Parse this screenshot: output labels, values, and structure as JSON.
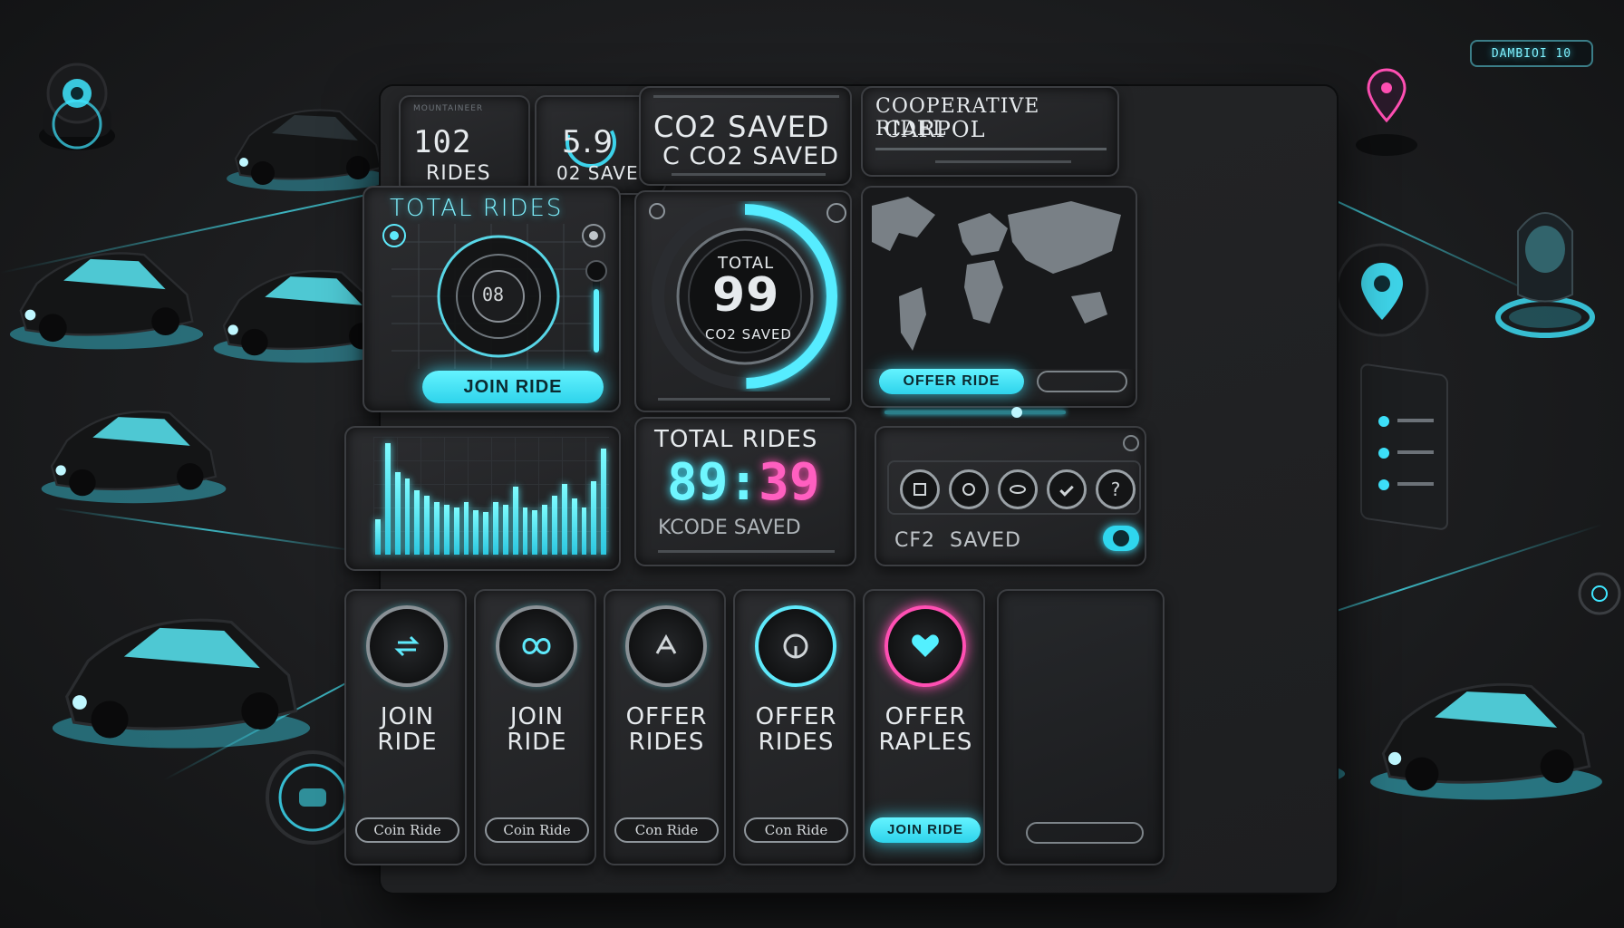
{
  "app": {
    "badge": "DAMBIOI 10"
  },
  "stats_top": {
    "rides_value": "102",
    "rides_label": "RIDES",
    "co2_value": "5.9",
    "co2_label": "02 SAVED",
    "small_header": "MOUNTAINEER"
  },
  "co2_card": {
    "line1": "CO2 SAVED",
    "line2": "C CO2 SAVED"
  },
  "cooperative_card": {
    "title_line1": "COOPERATIVE RIDEL",
    "title_line2": "CARPOL"
  },
  "total_rides_panel": {
    "title": "TOTAL RIDES",
    "center_text": "08",
    "join_button": "JOIN RIDE"
  },
  "gauge_panel": {
    "label_top": "TOTAL",
    "value": "99",
    "label_bottom": "CO2 SAVED"
  },
  "map_panel": {
    "offer_button": "OFFER RIDE"
  },
  "bar_chart": {
    "values": [
      30,
      95,
      70,
      65,
      55,
      50,
      45,
      42,
      40,
      45,
      38,
      36,
      45,
      42,
      58,
      40,
      38,
      42,
      50,
      60,
      48,
      40,
      62,
      90
    ]
  },
  "total_rides_counter": {
    "title": "TOTAL RIDES",
    "value_cyan": "89:",
    "value_pink": "39",
    "subtitle": "KCODE SAVED"
  },
  "icon_row_panel": {
    "saved_label": "CF2  SAVED"
  },
  "action_cards": [
    {
      "line1": "JOIN",
      "line2": "RIDE",
      "button": "Coin Ride",
      "icon": "swap-arrows-icon",
      "active": false
    },
    {
      "line1": "JOIN",
      "line2": "RIDE",
      "button": "Coin Ride",
      "icon": "infinity-icon",
      "active": false
    },
    {
      "line1": "OFFER",
      "line2": "RIDES",
      "button": "Con Ride",
      "icon": "route-share-icon",
      "active": false
    },
    {
      "line1": "OFFER",
      "line2": "RIDES",
      "button": "Con Ride",
      "icon": "steering-icon",
      "active": false
    },
    {
      "line1": "OFFER",
      "line2": "RAPLES",
      "button": "JOIN RIDE",
      "icon": "heart-icon",
      "active": true
    }
  ],
  "colors": {
    "accent": "#3fe6ff",
    "accent_pink": "#ff4fb3",
    "panel_bg": "#2a2b2e",
    "background": "#1c1d1f"
  }
}
